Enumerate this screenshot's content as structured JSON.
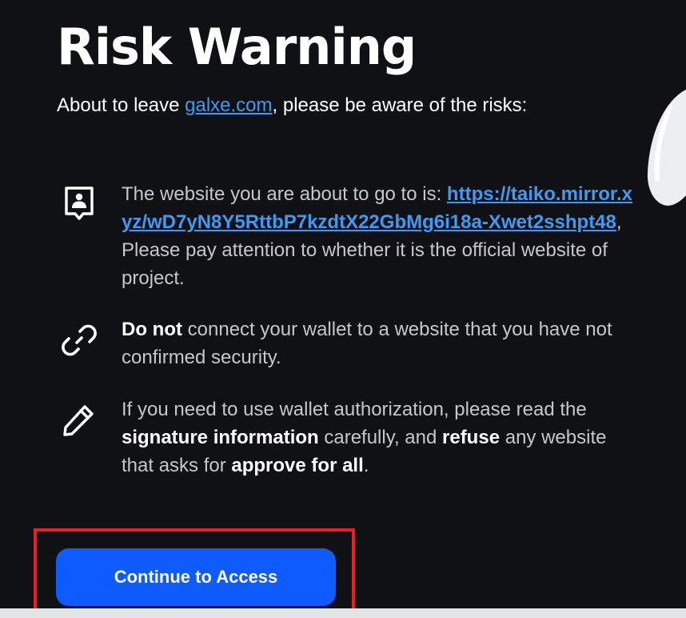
{
  "dialog": {
    "title": "Risk Warning",
    "subtitle_prefix": "About to leave ",
    "subtitle_link": "galxe.com",
    "subtitle_suffix": ", please be aware of the risks:"
  },
  "warnings": [
    {
      "icon": "profile-card-icon",
      "text_before_url": "The website you are about to go to is: ",
      "url": "https://taiko.mirror.xyz/wD7yN8Y5RttbP7kzdtX22GbMg6i18a-Xwet2sshpt48",
      "text_after_url": ", Please pay attention to whether it is the official website of project."
    },
    {
      "icon": "link-icon",
      "bold_1": "Do not",
      "text_1": " connect your wallet to a website that you have not confirmed security."
    },
    {
      "icon": "pencil-icon",
      "text_1": "If you need to use wallet authorization, please read the ",
      "bold_1": "signature information",
      "text_2": " carefully, and ",
      "bold_2": "refuse",
      "text_3": " any website that asks for ",
      "bold_3": "approve for all",
      "text_4": "."
    }
  ],
  "actions": {
    "continue_label": "Continue to Access"
  },
  "colors": {
    "background": "#0f1114",
    "link": "#3d9bf5",
    "primary_button": "#0e5bff",
    "highlight": "#ee1c25"
  }
}
